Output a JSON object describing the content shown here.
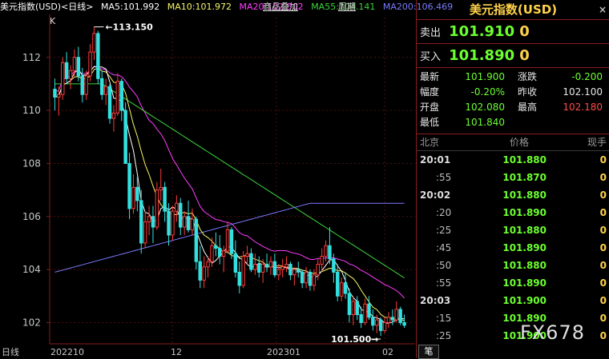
{
  "header": {
    "symbol_label": "美元指数(USD)<日线>",
    "ma5": "MA5:101.992",
    "ma10": "MA10:101.972",
    "ma20": "MA20:102.502",
    "ma55": "MA55:104.141",
    "ma200": "MA200:106.469",
    "overlay_button": "商品叠加",
    "period_button": "周期",
    "k_label": "K"
  },
  "chart": {
    "y_ticks": [
      "112",
      "110",
      "108",
      "106",
      "104",
      "102"
    ],
    "x_ticks": [
      "日线",
      "202210",
      "12",
      "202301",
      "02"
    ],
    "high_marker": "113.150",
    "low_marker": "101.500",
    "colors": {
      "up": "#ff3b3b",
      "down": "#33e0e0",
      "ma5": "#ffffff",
      "ma10": "#f5f56a",
      "ma20": "#ff3cff",
      "ma55": "#3cd63c",
      "ma200": "#7a7aff"
    }
  },
  "chart_data": {
    "type": "candlestick",
    "title": "美元指数(USD)<日线>",
    "ylim": [
      101.2,
      113.5
    ],
    "candles": [
      [
        110.8,
        111.2,
        110.0,
        110.5
      ],
      [
        110.5,
        110.9,
        109.8,
        110.6
      ],
      [
        110.6,
        112.0,
        110.4,
        111.8
      ],
      [
        111.8,
        112.2,
        111.0,
        111.2
      ],
      [
        111.2,
        111.7,
        110.8,
        111.5
      ],
      [
        111.5,
        112.3,
        111.3,
        112.0
      ],
      [
        112.0,
        112.4,
        111.1,
        111.3
      ],
      [
        111.3,
        111.6,
        110.3,
        110.6
      ],
      [
        110.6,
        111.5,
        110.4,
        111.3
      ],
      [
        111.3,
        112.5,
        111.1,
        112.2
      ],
      [
        112.2,
        113.15,
        111.9,
        112.9
      ],
      [
        112.9,
        113.0,
        111.0,
        111.2
      ],
      [
        111.2,
        111.5,
        110.4,
        110.6
      ],
      [
        110.6,
        111.2,
        110.2,
        110.9
      ],
      [
        110.9,
        111.0,
        109.5,
        109.7
      ],
      [
        109.7,
        110.2,
        109.2,
        109.9
      ],
      [
        109.9,
        111.4,
        109.8,
        111.1
      ],
      [
        111.1,
        111.2,
        109.6,
        110.0
      ],
      [
        110.0,
        110.3,
        108.3,
        108.0
      ],
      [
        108.0,
        108.4,
        105.9,
        106.3
      ],
      [
        106.3,
        107.6,
        106.1,
        107.1
      ],
      [
        107.1,
        107.5,
        106.2,
        106.6
      ],
      [
        106.6,
        107.0,
        104.6,
        105.0
      ],
      [
        105.0,
        106.2,
        104.8,
        105.8
      ],
      [
        105.8,
        106.4,
        105.3,
        106.0
      ],
      [
        106.0,
        106.4,
        105.0,
        105.6
      ],
      [
        105.6,
        107.3,
        105.5,
        107.0
      ],
      [
        107.0,
        107.8,
        106.6,
        107.1
      ],
      [
        107.1,
        107.3,
        105.8,
        106.2
      ],
      [
        106.2,
        106.5,
        104.9,
        105.3
      ],
      [
        105.3,
        106.4,
        105.1,
        106.2
      ],
      [
        106.2,
        106.8,
        105.8,
        106.5
      ],
      [
        106.5,
        106.7,
        105.3,
        105.6
      ],
      [
        105.6,
        106.2,
        105.3,
        106.0
      ],
      [
        106.0,
        106.6,
        105.4,
        105.5
      ],
      [
        105.5,
        106.3,
        105.3,
        105.9
      ],
      [
        105.9,
        106.0,
        104.0,
        104.3
      ],
      [
        104.3,
        104.9,
        103.3,
        103.6
      ],
      [
        103.6,
        104.5,
        103.3,
        104.1
      ],
      [
        104.1,
        104.5,
        103.7,
        104.3
      ],
      [
        104.3,
        105.2,
        104.1,
        104.9
      ],
      [
        104.9,
        105.4,
        104.5,
        104.8
      ],
      [
        104.8,
        105.3,
        104.2,
        104.5
      ],
      [
        104.5,
        104.9,
        103.9,
        104.7
      ],
      [
        104.7,
        105.8,
        104.6,
        105.5
      ],
      [
        105.5,
        105.6,
        104.4,
        104.6
      ],
      [
        104.6,
        105.1,
        103.7,
        103.9
      ],
      [
        103.9,
        104.3,
        103.1,
        103.4
      ],
      [
        103.4,
        104.7,
        103.3,
        104.5
      ],
      [
        104.5,
        104.9,
        104.2,
        104.6
      ],
      [
        104.6,
        104.8,
        103.9,
        104.0
      ],
      [
        104.0,
        104.6,
        103.8,
        104.2
      ],
      [
        104.2,
        104.5,
        103.7,
        103.9
      ],
      [
        103.9,
        104.4,
        103.5,
        104.2
      ],
      [
        104.2,
        104.6,
        103.9,
        104.1
      ],
      [
        104.1,
        104.5,
        103.8,
        104.3
      ],
      [
        104.3,
        104.6,
        103.7,
        103.8
      ],
      [
        103.8,
        104.2,
        103.6,
        104.0
      ],
      [
        104.0,
        104.4,
        103.7,
        104.1
      ],
      [
        104.1,
        104.5,
        103.9,
        104.2
      ],
      [
        104.2,
        104.3,
        103.6,
        103.8
      ],
      [
        103.8,
        104.1,
        103.4,
        104.0
      ],
      [
        104.0,
        104.3,
        103.7,
        103.9
      ],
      [
        103.9,
        104.0,
        103.3,
        103.5
      ],
      [
        103.5,
        104.1,
        103.3,
        103.9
      ],
      [
        103.9,
        104.0,
        103.2,
        103.4
      ],
      [
        103.4,
        104.0,
        103.2,
        103.8
      ],
      [
        103.8,
        104.4,
        103.6,
        104.2
      ],
      [
        104.2,
        104.8,
        103.9,
        104.5
      ],
      [
        104.5,
        105.1,
        104.3,
        104.9
      ],
      [
        104.9,
        105.6,
        104.2,
        104.4
      ],
      [
        104.4,
        104.6,
        103.5,
        103.9
      ],
      [
        103.9,
        104.2,
        102.8,
        103.0
      ],
      [
        103.0,
        103.7,
        102.8,
        103.5
      ],
      [
        103.5,
        103.9,
        102.9,
        103.1
      ],
      [
        103.1,
        103.3,
        102.0,
        102.3
      ],
      [
        102.3,
        103.0,
        101.9,
        102.8
      ],
      [
        102.8,
        103.0,
        102.1,
        102.3
      ],
      [
        102.3,
        102.6,
        101.8,
        102.0
      ],
      [
        102.0,
        102.9,
        101.9,
        102.7
      ],
      [
        102.7,
        103.0,
        102.1,
        102.2
      ],
      [
        102.2,
        102.5,
        101.7,
        101.9
      ],
      [
        101.9,
        102.3,
        101.6,
        102.1
      ],
      [
        102.1,
        102.2,
        101.5,
        101.7
      ],
      [
        101.7,
        102.2,
        101.6,
        102.0
      ],
      [
        102.0,
        102.4,
        101.8,
        102.2
      ],
      [
        102.2,
        102.5,
        101.9,
        102.1
      ],
      [
        102.1,
        102.8,
        102.0,
        102.5
      ],
      [
        102.5,
        102.6,
        101.9,
        102.0
      ],
      [
        102.0,
        102.3,
        101.8,
        101.9
      ]
    ]
  },
  "side": {
    "title": "美元指数(USD)",
    "close_icon": "×",
    "sell": {
      "label": "卖出",
      "price": "101.910",
      "volume": "0"
    },
    "buy": {
      "label": "买入",
      "price": "101.890",
      "volume": "0"
    },
    "stats": [
      {
        "k1": "最新",
        "v1": "101.900",
        "c1": "#6cff2f",
        "k2": "涨跌",
        "v2": "-0.200",
        "c2": "#6cff2f"
      },
      {
        "k1": "幅度",
        "v1": "-0.20%",
        "c1": "#6cff2f",
        "k2": "昨收",
        "v2": "102.100",
        "c2": "#e8e8e8"
      },
      {
        "k1": "开盘",
        "v1": "102.080",
        "c1": "#6cff2f",
        "k2": "最高",
        "v2": "102.180",
        "c2": "#ff4a4a"
      },
      {
        "k1": "最低",
        "v1": "101.840",
        "c1": "#6cff2f",
        "k2": "",
        "v2": "",
        "c2": "#e8e8e8"
      }
    ],
    "ticks_header": {
      "city": "北京",
      "price": "价格",
      "volume": "现手"
    },
    "ticks": [
      {
        "time": "20:01",
        "sub": false,
        "price": "101.880",
        "vol": "0"
      },
      {
        "time": ":55",
        "sub": true,
        "price": "101.870",
        "vol": "0"
      },
      {
        "time": "20:02",
        "sub": false,
        "price": "101.880",
        "vol": "0"
      },
      {
        "time": ":20",
        "sub": true,
        "price": "101.890",
        "vol": "0"
      },
      {
        "time": ":25",
        "sub": true,
        "price": "101.880",
        "vol": "0"
      },
      {
        "time": ":45",
        "sub": true,
        "price": "101.890",
        "vol": "0"
      },
      {
        "time": ":50",
        "sub": true,
        "price": "101.880",
        "vol": "0"
      },
      {
        "time": ":55",
        "sub": true,
        "price": "101.890",
        "vol": "0"
      },
      {
        "time": "20:03",
        "sub": false,
        "price": "101.900",
        "vol": "0"
      },
      {
        "time": ":15",
        "sub": true,
        "price": "101.890",
        "vol": "0"
      },
      {
        "time": ":25",
        "sub": true,
        "price": "101.900",
        "vol": "0"
      }
    ],
    "bottom_tab": "笔",
    "watermark": "FX678"
  }
}
